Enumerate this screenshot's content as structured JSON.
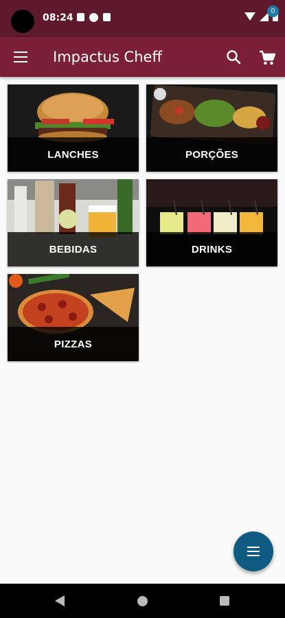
{
  "status_bar": {
    "time": "08:24",
    "icons": [
      "notification-a-icon",
      "notification-f-icon",
      "notification-clipboard-icon"
    ],
    "right_icons": [
      "wifi-icon",
      "signal-icon",
      "battery-icon"
    ]
  },
  "app_bar": {
    "title": "Impactus Cheff",
    "cart_count": "0",
    "color": "#7b2036"
  },
  "categories": [
    {
      "label": "LANCHES",
      "image": "burger-photo"
    },
    {
      "label": "PORÇÕES",
      "image": "portions-platter-photo"
    },
    {
      "label": "BEBIDAS",
      "image": "beverages-bottles-photo"
    },
    {
      "label": "DRINKS",
      "image": "cocktail-glasses-photo"
    },
    {
      "label": "PIZZAS",
      "image": "pizza-photo"
    }
  ],
  "fab": {
    "icon": "list-menu-icon",
    "color": "#0e5a80"
  },
  "nav_bar": {
    "icons": [
      "back-icon",
      "home-icon",
      "recent-apps-icon"
    ]
  }
}
